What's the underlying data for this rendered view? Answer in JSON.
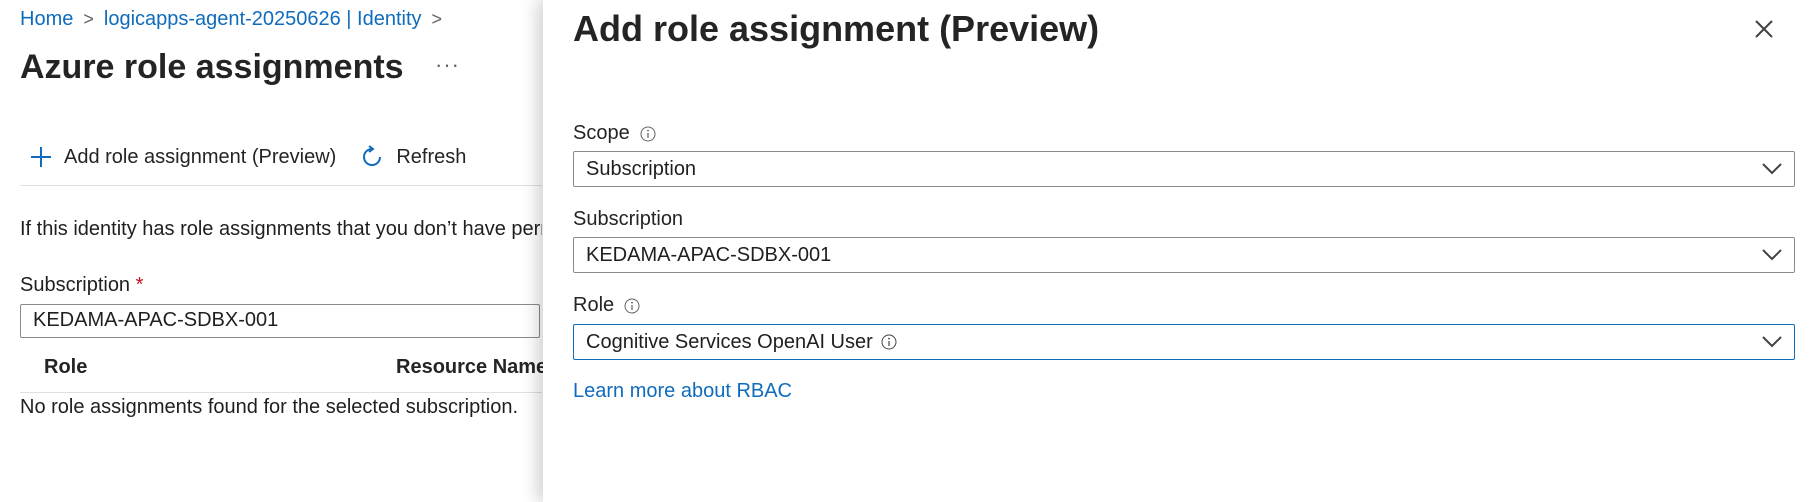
{
  "breadcrumb": {
    "home": "Home",
    "resource": "logicapps-agent-20250626 | Identity"
  },
  "page": {
    "title": "Azure role assignments",
    "more": "···"
  },
  "toolbar": {
    "add_label": "Add role assignment (Preview)",
    "refresh_label": "Refresh"
  },
  "info_text": "If this identity has role assignments that you don’t have perm",
  "filter": {
    "label": "Subscription",
    "required_mark": "*",
    "value": "KEDAMA-APAC-SDBX-001"
  },
  "table": {
    "columns": [
      "Role",
      "Resource Name"
    ],
    "empty_message": "No role assignments found for the selected subscription."
  },
  "panel": {
    "title": "Add role assignment (Preview)",
    "scope": {
      "label": "Scope",
      "value": "Subscription"
    },
    "subscription": {
      "label": "Subscription",
      "value": "KEDAMA-APAC-SDBX-001"
    },
    "role": {
      "label": "Role",
      "value": "Cognitive Services OpenAI User"
    },
    "learn_more": "Learn more about RBAC"
  },
  "colors": {
    "link": "#0f6cbd",
    "required": "#c50f1f",
    "focus_border": "#0f6cbd"
  }
}
